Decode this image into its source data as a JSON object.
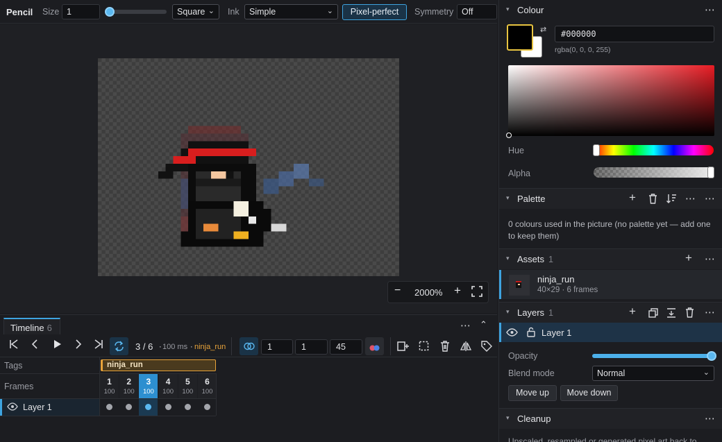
{
  "toolbar": {
    "tool": "Pencil",
    "size_label": "Size",
    "size_value": "1",
    "size_fraction": 0.0,
    "brush_shape": "Square",
    "ink_label": "Ink",
    "ink_value": "Simple",
    "pixel_perfect": "Pixel-perfect",
    "symmetry_label": "Symmetry",
    "symmetry_value": "Off"
  },
  "canvas": {
    "zoom": "2000%",
    "zoom_out": "−",
    "zoom_in": "+",
    "fit_icon": "fit-screen-icon"
  },
  "timeline": {
    "tab_label": "Timeline",
    "tab_count": "6",
    "frame_position": "3 / 6",
    "frame_duration": "100 ms",
    "tag_name": "ninja_run",
    "onion_prev": "1",
    "onion_next": "1",
    "onion_opacity": "45",
    "tags_label": "Tags",
    "frames_label": "Frames",
    "layer_name": "Layer 1",
    "frames": [
      {
        "n": "1",
        "d": "100"
      },
      {
        "n": "2",
        "d": "100"
      },
      {
        "n": "3",
        "d": "100"
      },
      {
        "n": "4",
        "d": "100"
      },
      {
        "n": "5",
        "d": "100"
      },
      {
        "n": "6",
        "d": "100"
      }
    ],
    "active_frame_index": 2
  },
  "colour": {
    "title": "Colour",
    "hex": "#000000",
    "rgba": "rgba(0, 0, 0, 255)",
    "primary": "#000000",
    "secondary": "#ffffff",
    "hue_label": "Hue",
    "alpha_label": "Alpha",
    "hue_fraction": 0.0,
    "alpha_fraction": 1.0
  },
  "palette": {
    "title": "Palette",
    "empty_text": "0 colours used in the picture (no palette yet — add one to keep them)"
  },
  "assets": {
    "title": "Assets",
    "count": "1",
    "item_name": "ninja_run",
    "item_meta": "40×29 · 6 frames"
  },
  "layers": {
    "title": "Layers",
    "count": "1",
    "layer_name": "Layer 1",
    "opacity_label": "Opacity",
    "opacity_fraction": 1.0,
    "blend_label": "Blend mode",
    "blend_value": "Normal",
    "move_up": "Move up",
    "move_down": "Move down"
  },
  "cleanup": {
    "title": "Cleanup",
    "text": "Upscaled, resampled or generated pixel art back to"
  },
  "colors": {
    "accent": "#3ea4e0",
    "tag": "#e8a33a"
  }
}
